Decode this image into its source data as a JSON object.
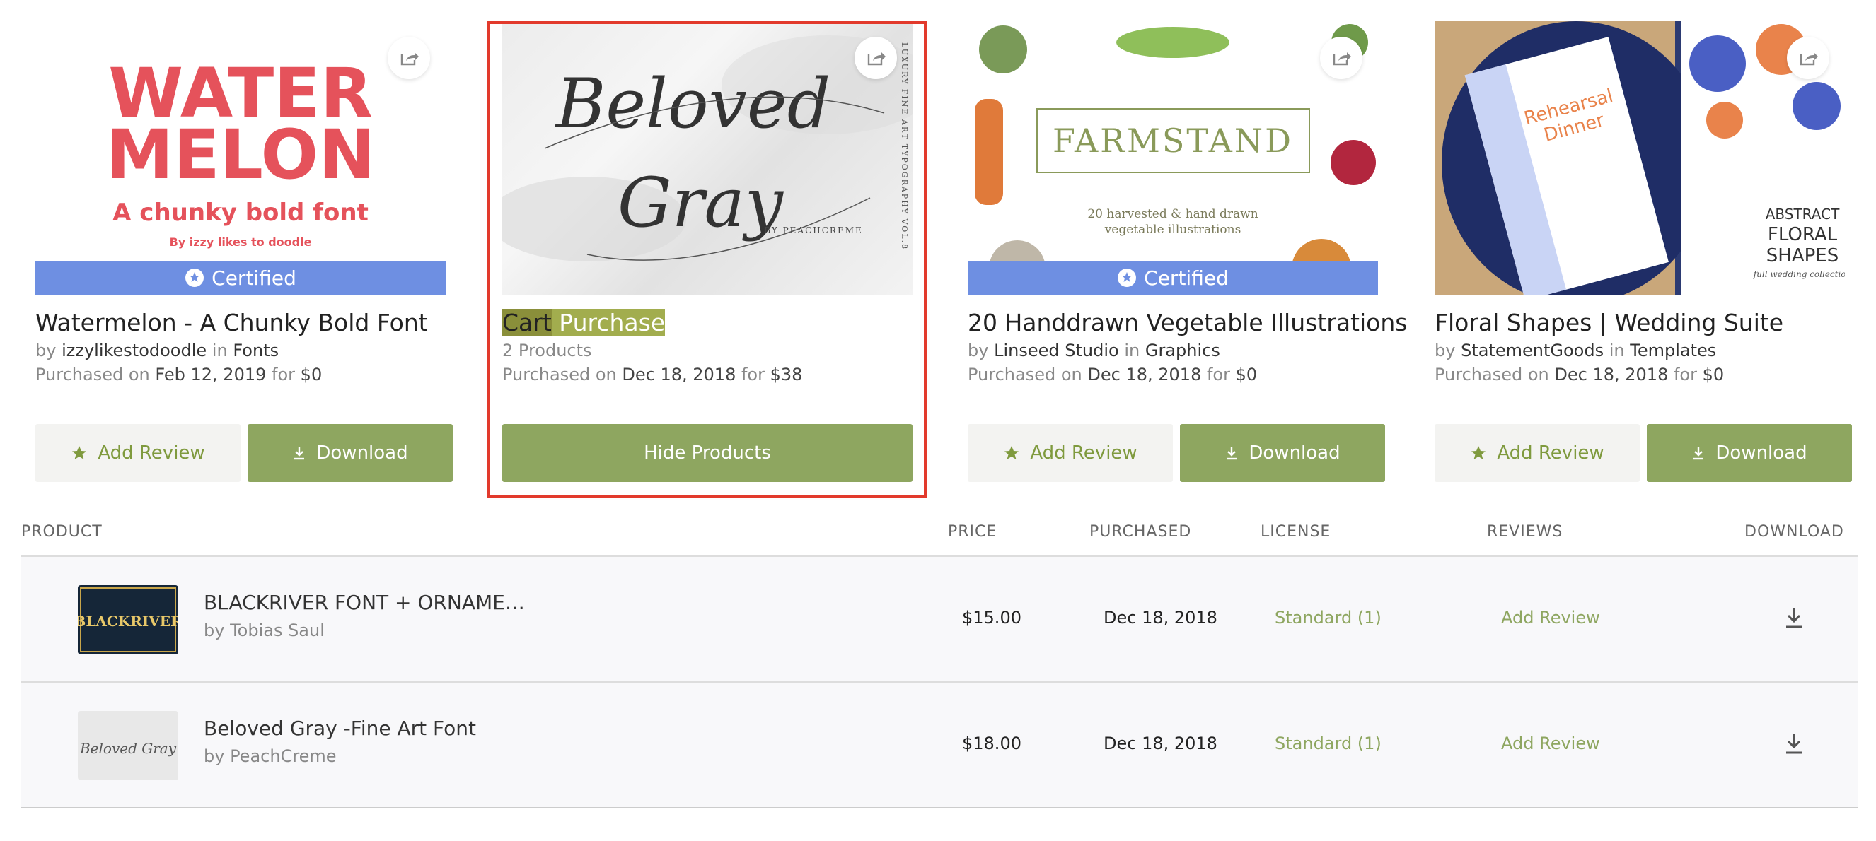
{
  "cards": [
    {
      "title": "Watermelon - A Chunky Bold Font",
      "by_label": "by",
      "author": "izzylikestodoodle",
      "in_label": "in",
      "category": "Fonts",
      "purchased_label": "Purchased on",
      "date": "Feb 12, 2019",
      "for_label": "for",
      "price": "$0",
      "certified": "Certified",
      "thumb_text": {
        "line1": "WATER",
        "line2": "MELON",
        "line3": "A chunky bold font",
        "line4": "By izzy likes to doodle"
      },
      "review_label": "Add Review",
      "download_label": "Download"
    },
    {
      "title_part1": "Cart",
      "title_part2": "Purchase",
      "count": "2 Products",
      "purchased_label": "Purchased on",
      "date": "Dec 18, 2018",
      "for_label": "for",
      "price": "$38",
      "thumb_text": {
        "line1": "Beloved",
        "line2": "Gray",
        "by": "BY PEACHCREME",
        "side": "LUXURY FINE ART TYPOGRAPHY VOL.8"
      },
      "hide_label": "Hide Products"
    },
    {
      "title": "20 Handdrawn Vegetable Illustrations",
      "by_label": "by",
      "author": "Linseed Studio",
      "in_label": "in",
      "category": "Graphics",
      "purchased_label": "Purchased on",
      "date": "Dec 18, 2018",
      "for_label": "for",
      "price": "$0",
      "certified": "Certified",
      "thumb_text": {
        "line1": "FARMSTAND",
        "line2": "20 harvested & hand drawn",
        "line3": "vegetable illustrations"
      },
      "review_label": "Add Review",
      "download_label": "Download"
    },
    {
      "title": "Floral Shapes | Wedding Suite",
      "by_label": "by",
      "author": "StatementGoods",
      "in_label": "in",
      "category": "Templates",
      "purchased_label": "Purchased on",
      "date": "Dec 18, 2018",
      "for_label": "for",
      "price": "$0",
      "thumb_text": {
        "line1": "ABSTRACT",
        "line2": "FLORAL",
        "line3": "SHAPES",
        "line4": "full wedding collection",
        "card1": "Rehearsal",
        "card2": "Dinner"
      },
      "review_label": "Add Review",
      "download_label": "Download"
    }
  ],
  "table": {
    "headers": {
      "product": "PRODUCT",
      "price": "PRICE",
      "purchased": "PURCHASED",
      "license": "LICENSE",
      "reviews": "REVIEWS",
      "download": "DOWNLOAD"
    },
    "rows": [
      {
        "name": "BLACKRIVER FONT + ORNAME…",
        "by": "by Tobias Saul",
        "price": "$15.00",
        "date": "Dec 18, 2018",
        "license": "Standard (1)",
        "review": "Add Review",
        "thumb_text": "BLACKRIVER"
      },
      {
        "name": "Beloved Gray -Fine Art Font",
        "by": "by PeachCreme",
        "price": "$18.00",
        "date": "Dec 18, 2018",
        "license": "Standard (1)",
        "review": "Add Review",
        "thumb_text": "Beloved Gray"
      }
    ]
  },
  "colors": {
    "accent_green": "#8ea660",
    "certified_blue": "#6e8fe2",
    "highlight_red": "#e23a2c"
  }
}
